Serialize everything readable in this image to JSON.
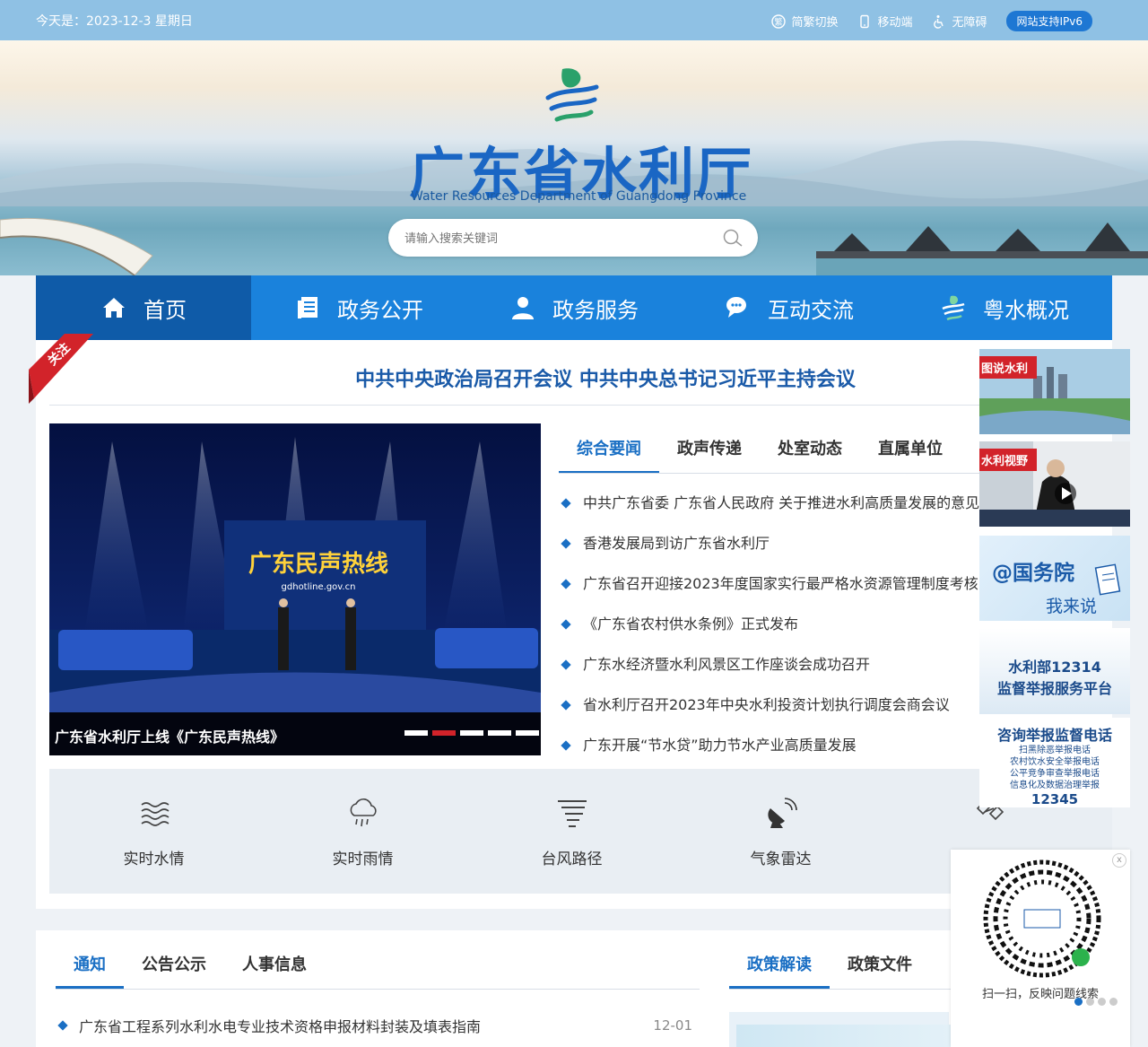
{
  "topbar": {
    "date": "今天是：2023-12-3 星期日",
    "links": [
      {
        "label": "简繁切换",
        "icon": "translate-icon"
      },
      {
        "label": "移动端",
        "icon": "mobile-icon"
      },
      {
        "label": "无障碍",
        "icon": "accessibility-icon"
      }
    ],
    "ipv6": "网站支持IPv6"
  },
  "header": {
    "title": "广东省水利厅",
    "subtitle": "Water Resources Department of Guangdong Province",
    "search_placeholder": "请输入搜索关键词"
  },
  "nav": [
    {
      "label": "首页",
      "icon": "home-icon",
      "active": true
    },
    {
      "label": "政务公开",
      "icon": "document-icon"
    },
    {
      "label": "政务服务",
      "icon": "user-icon"
    },
    {
      "label": "互动交流",
      "icon": "chat-icon"
    },
    {
      "label": "粤水概况",
      "icon": "logo-icon"
    }
  ],
  "headline": {
    "ribbon": "关注",
    "text": "中共中央政治局召开会议 中共中央总书记习近平主持会议"
  },
  "carousel": {
    "caption": "广东省水利厅上线《广东民声热线》",
    "screen_text": "广东民声热线",
    "url_text": "gdhotline.gov.cn",
    "active_dot": 2,
    "dot_count": 5
  },
  "news_tabs": [
    "综合要闻",
    "政声传递",
    "处室动态",
    "直属单位"
  ],
  "news": [
    "中共广东省委 广东省人民政府 关于推进水利高质量发展的意见",
    "香港发展局到访广东省水利厅",
    "广东省召开迎接2023年度国家实行最严格水资源管理制度考核",
    "《广东省农村供水条例》正式发布",
    "广东水经济暨水利风景区工作座谈会成功召开",
    "省水利厅召开2023年中央水利投资计划执行调度会商会议",
    "广东开展“节水贷”助力节水产业高质量发展"
  ],
  "quick_links": [
    {
      "label": "实时水情",
      "icon": "water-level-icon"
    },
    {
      "label": "实时雨情",
      "icon": "rain-cloud-icon"
    },
    {
      "label": "台风路径",
      "icon": "typhoon-icon"
    },
    {
      "label": "气象雷达",
      "icon": "radar-icon"
    },
    {
      "label": "",
      "icon": "satellite-icon"
    }
  ],
  "notice_tabs": [
    "通知",
    "公告公示",
    "人事信息"
  ],
  "notices": [
    {
      "title": "广东省工程系列水利水电专业技术资格申报材料封装及填表指南",
      "date": "12-01"
    }
  ],
  "policy_tabs": [
    "政策解读",
    "政策文件"
  ],
  "side": {
    "tushuo": "图说水利",
    "shiye": "水利视野",
    "gwy_1": "@国务院",
    "gwy_2": "我来说",
    "report_1": "水利部12314",
    "report_2": "监督举报服务平台",
    "hotline_title": "咨询举报监督电话",
    "hotline_lines": [
      "扫黑除恶举报电话",
      "农村饮水安全举报电话",
      "公平竞争审查举报电话",
      "信息化及数据治理举报"
    ],
    "hotline_num": "12345",
    "qr_text": "扫一扫，反映问题线索",
    "qr_close": "x"
  },
  "colors": {
    "primary": "#1a82dc",
    "nav_active": "#0f5ba8",
    "accent_red": "#d2232a",
    "link_blue": "#1a6fc4"
  }
}
